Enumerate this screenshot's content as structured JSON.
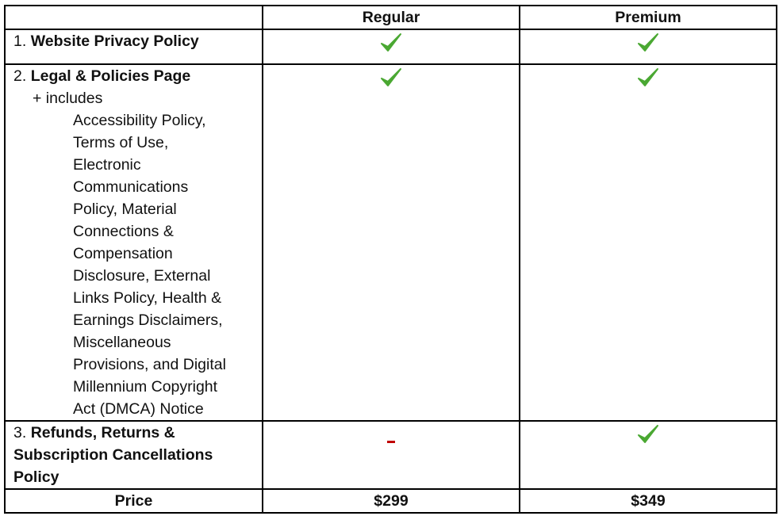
{
  "colors": {
    "check": "#4aa832",
    "dash": "#c00000",
    "border": "#000000"
  },
  "header": {
    "col0": "",
    "col1": "Regular",
    "col2": "Premium"
  },
  "rows": [
    {
      "num": "1.",
      "title": "Website Privacy Policy",
      "regular": "check-icon",
      "premium": "check-icon"
    },
    {
      "num": "2.",
      "title": "Legal & Policies Page",
      "sub": "+ includes",
      "lines": [
        "Accessibility Policy,",
        "Terms of Use,",
        "Electronic",
        "Communications",
        "Policy, Material",
        "Connections &",
        "Compensation",
        "Disclosure, External",
        "Links Policy, Health &",
        "Earnings Disclaimers,",
        "Miscellaneous",
        "Provisions, and Digital",
        "Millennium Copyright",
        "Act (DMCA) Notice"
      ],
      "regular": "check-icon",
      "premium": "check-icon"
    },
    {
      "num": "3.",
      "title_lines": [
        "Refunds, Returns &",
        "Subscription Cancellations",
        "Policy"
      ],
      "regular": "dash-icon",
      "premium": "check-icon"
    }
  ],
  "price": {
    "label": "Price",
    "regular": "$299",
    "premium": "$349"
  }
}
